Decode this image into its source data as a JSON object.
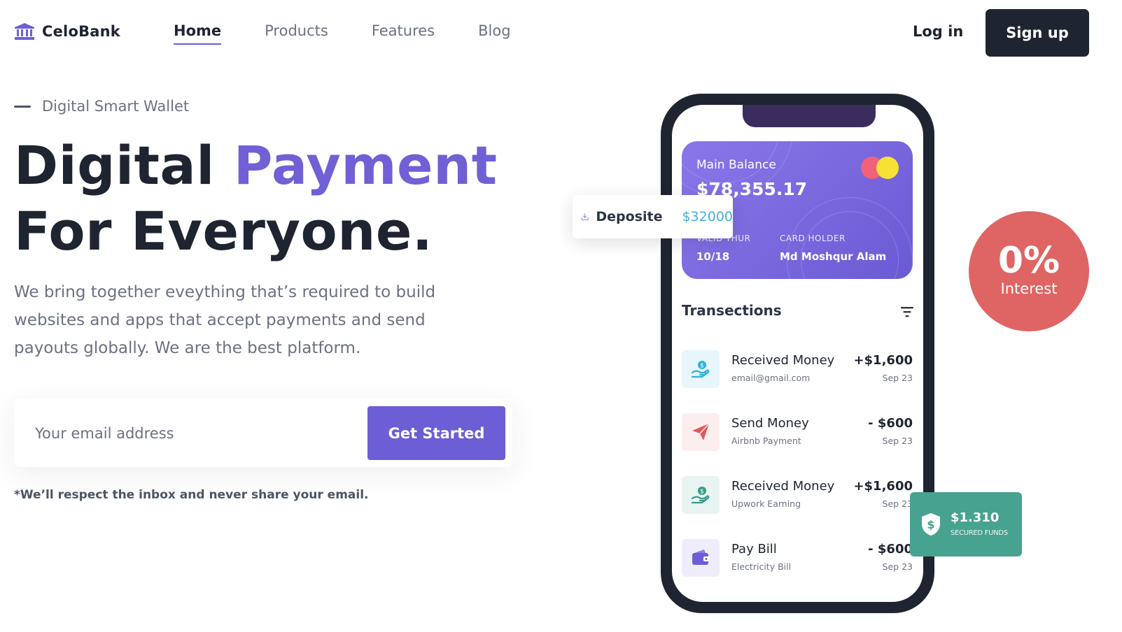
{
  "brand": {
    "name": "CeloBank",
    "accent": "#6c5ed4"
  },
  "nav": {
    "items": [
      {
        "label": "Home",
        "active": true
      },
      {
        "label": "Products",
        "active": false
      },
      {
        "label": "Features",
        "active": false
      },
      {
        "label": "Blog",
        "active": false
      }
    ],
    "login_label": "Log in",
    "signup_label": "Sign up"
  },
  "hero": {
    "eyebrow": "Digital Smart Wallet",
    "headline_part1": "Digital ",
    "headline_accent": "Payment",
    "headline_line2": "For Everyone.",
    "description": "We bring together eveything that’s required to build websites and apps that accept payments and send payouts globally. We are the best platform.",
    "email_placeholder": "Your email address",
    "cta_label": "Get Started",
    "privacy_note": "*We’ll respect the inbox and never share your email."
  },
  "card": {
    "balance_label": "Main Balance",
    "balance_value": "$78,355.17",
    "valid_label": "VALID THUR",
    "valid_value": "10/18",
    "holder_label": "CARD HOLDER",
    "holder_value": "Md Moshqur Alam"
  },
  "deposit": {
    "label": "Deposite",
    "value": "$32000"
  },
  "transactions": {
    "title": "Transections",
    "items": [
      {
        "title": "Received Money",
        "subtitle": "email@gmail.com",
        "amount": "+$1,600",
        "date": "Sep 23",
        "icon": "hand-coin-icon",
        "color": "#2fb0d8",
        "bg": "#e6f6fb"
      },
      {
        "title": "Send Money",
        "subtitle": "Airbnb Payment",
        "amount": "- $600",
        "date": "Sep 23",
        "icon": "paper-plane-icon",
        "color": "#e0595b",
        "bg": "#fdeeee"
      },
      {
        "title": "Received Money",
        "subtitle": "Upwork Earning",
        "amount": "+$1,600",
        "date": "Sep 23",
        "icon": "hand-coin-icon",
        "color": "#3a9a87",
        "bg": "#e7f4f1"
      },
      {
        "title": "Pay Bill",
        "subtitle": "Electricity Bill",
        "amount": "- $600",
        "date": "Sep 23",
        "icon": "wallet-icon",
        "color": "#6c5ed4",
        "bg": "#efedfb"
      }
    ]
  },
  "interest": {
    "value": "0%",
    "label": "Interest"
  },
  "secured": {
    "value": "$1.310",
    "label": "SECURED FUNDS"
  }
}
